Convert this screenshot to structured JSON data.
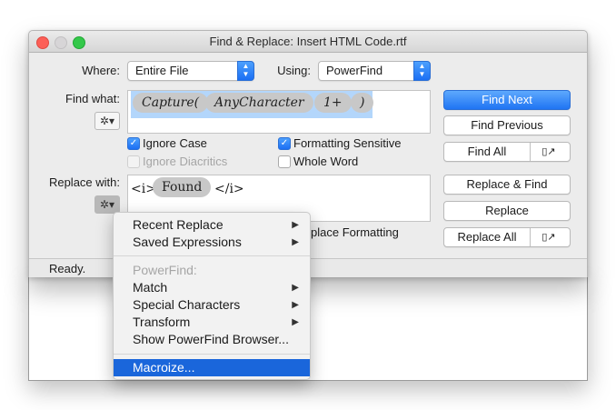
{
  "window": {
    "title": "Find & Replace: Insert HTML Code.rtf"
  },
  "where": {
    "label": "Where:",
    "value": "Entire File"
  },
  "using": {
    "label": "Using:",
    "value": "PowerFind"
  },
  "find": {
    "label": "Find what:",
    "tokens": [
      "Capture(",
      "AnyCharacter",
      "1+",
      ")"
    ]
  },
  "options": {
    "ignore_case": "Ignore Case",
    "formatting_sensitive": "Formatting Sensitive",
    "ignore_diacritics": "Ignore Diacritics",
    "whole_word": "Whole Word",
    "replace_formatting": "Replace Formatting",
    "replace_formatting_partial": "place Formatting"
  },
  "replace": {
    "label": "Replace with:",
    "pre": "<i>",
    "token": "Found",
    "post": "</i>"
  },
  "buttons": {
    "find_next": "Find Next",
    "find_previous": "Find Previous",
    "find_all": "Find All",
    "replace_and_find": "Replace & Find",
    "replace": "Replace",
    "replace_all": "Replace All"
  },
  "status": "Ready.",
  "menu": {
    "recent_replace": "Recent Replace",
    "saved_expressions": "Saved Expressions",
    "powerfind_header": "PowerFind:",
    "match": "Match",
    "special_characters": "Special Characters",
    "transform": "Transform",
    "show_browser": "Show PowerFind Browser...",
    "macroize": "Macroize..."
  },
  "colors": {
    "accent": "#1a66db",
    "token_bg": "#c8c8c8",
    "selection": "#b3d6fb"
  }
}
